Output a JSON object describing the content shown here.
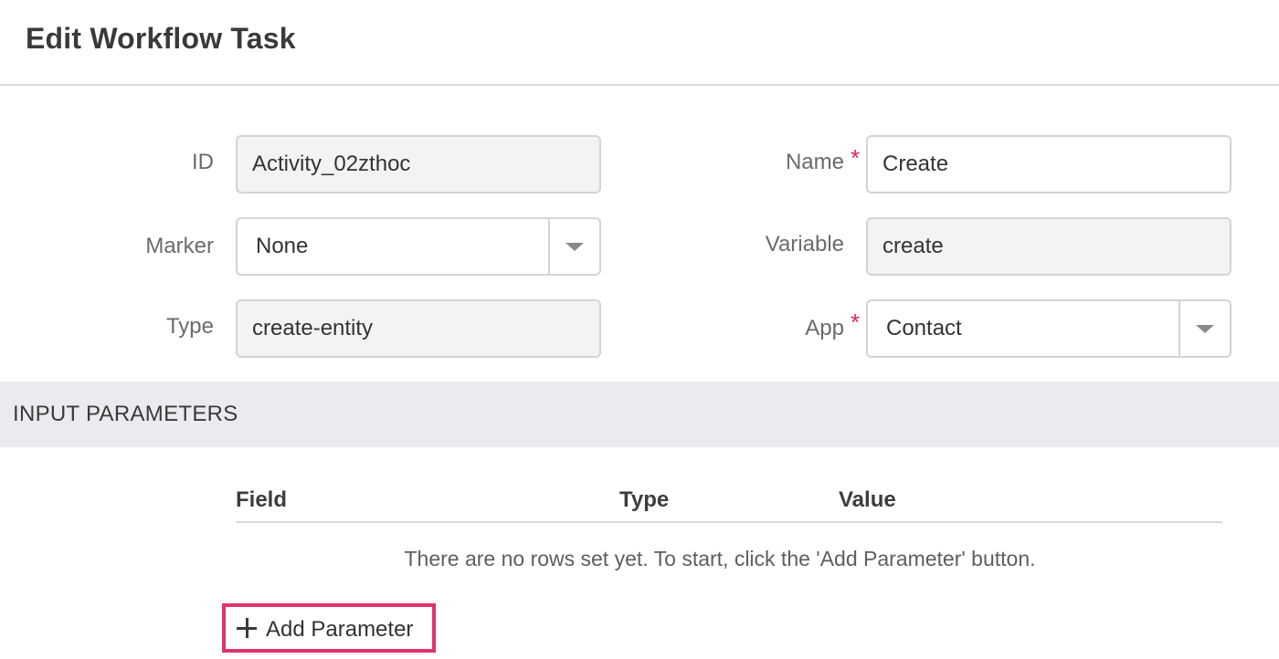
{
  "header": {
    "title": "Edit Workflow Task"
  },
  "form": {
    "id": {
      "label": "ID",
      "value": "Activity_02zthoc"
    },
    "marker": {
      "label": "Marker",
      "value": "None"
    },
    "type": {
      "label": "Type",
      "value": "create-entity"
    },
    "name": {
      "label": "Name",
      "value": "Create",
      "required_mark": "*"
    },
    "variable": {
      "label": "Variable",
      "value": "create"
    },
    "app": {
      "label": "App",
      "value": "Contact",
      "required_mark": "*"
    }
  },
  "input_parameters": {
    "section_title": "INPUT PARAMETERS",
    "columns": [
      "Field",
      "Type",
      "Value"
    ],
    "empty_message": "There are no rows set yet. To start, click the 'Add Parameter' button.",
    "add_button_label": "Add Parameter"
  },
  "icons": {
    "add": "plus-icon",
    "dropdown": "chevron-down-icon"
  },
  "colors": {
    "required": "#e0245e",
    "highlight_border": "#e0336c",
    "section_bg": "#e9ebef"
  }
}
